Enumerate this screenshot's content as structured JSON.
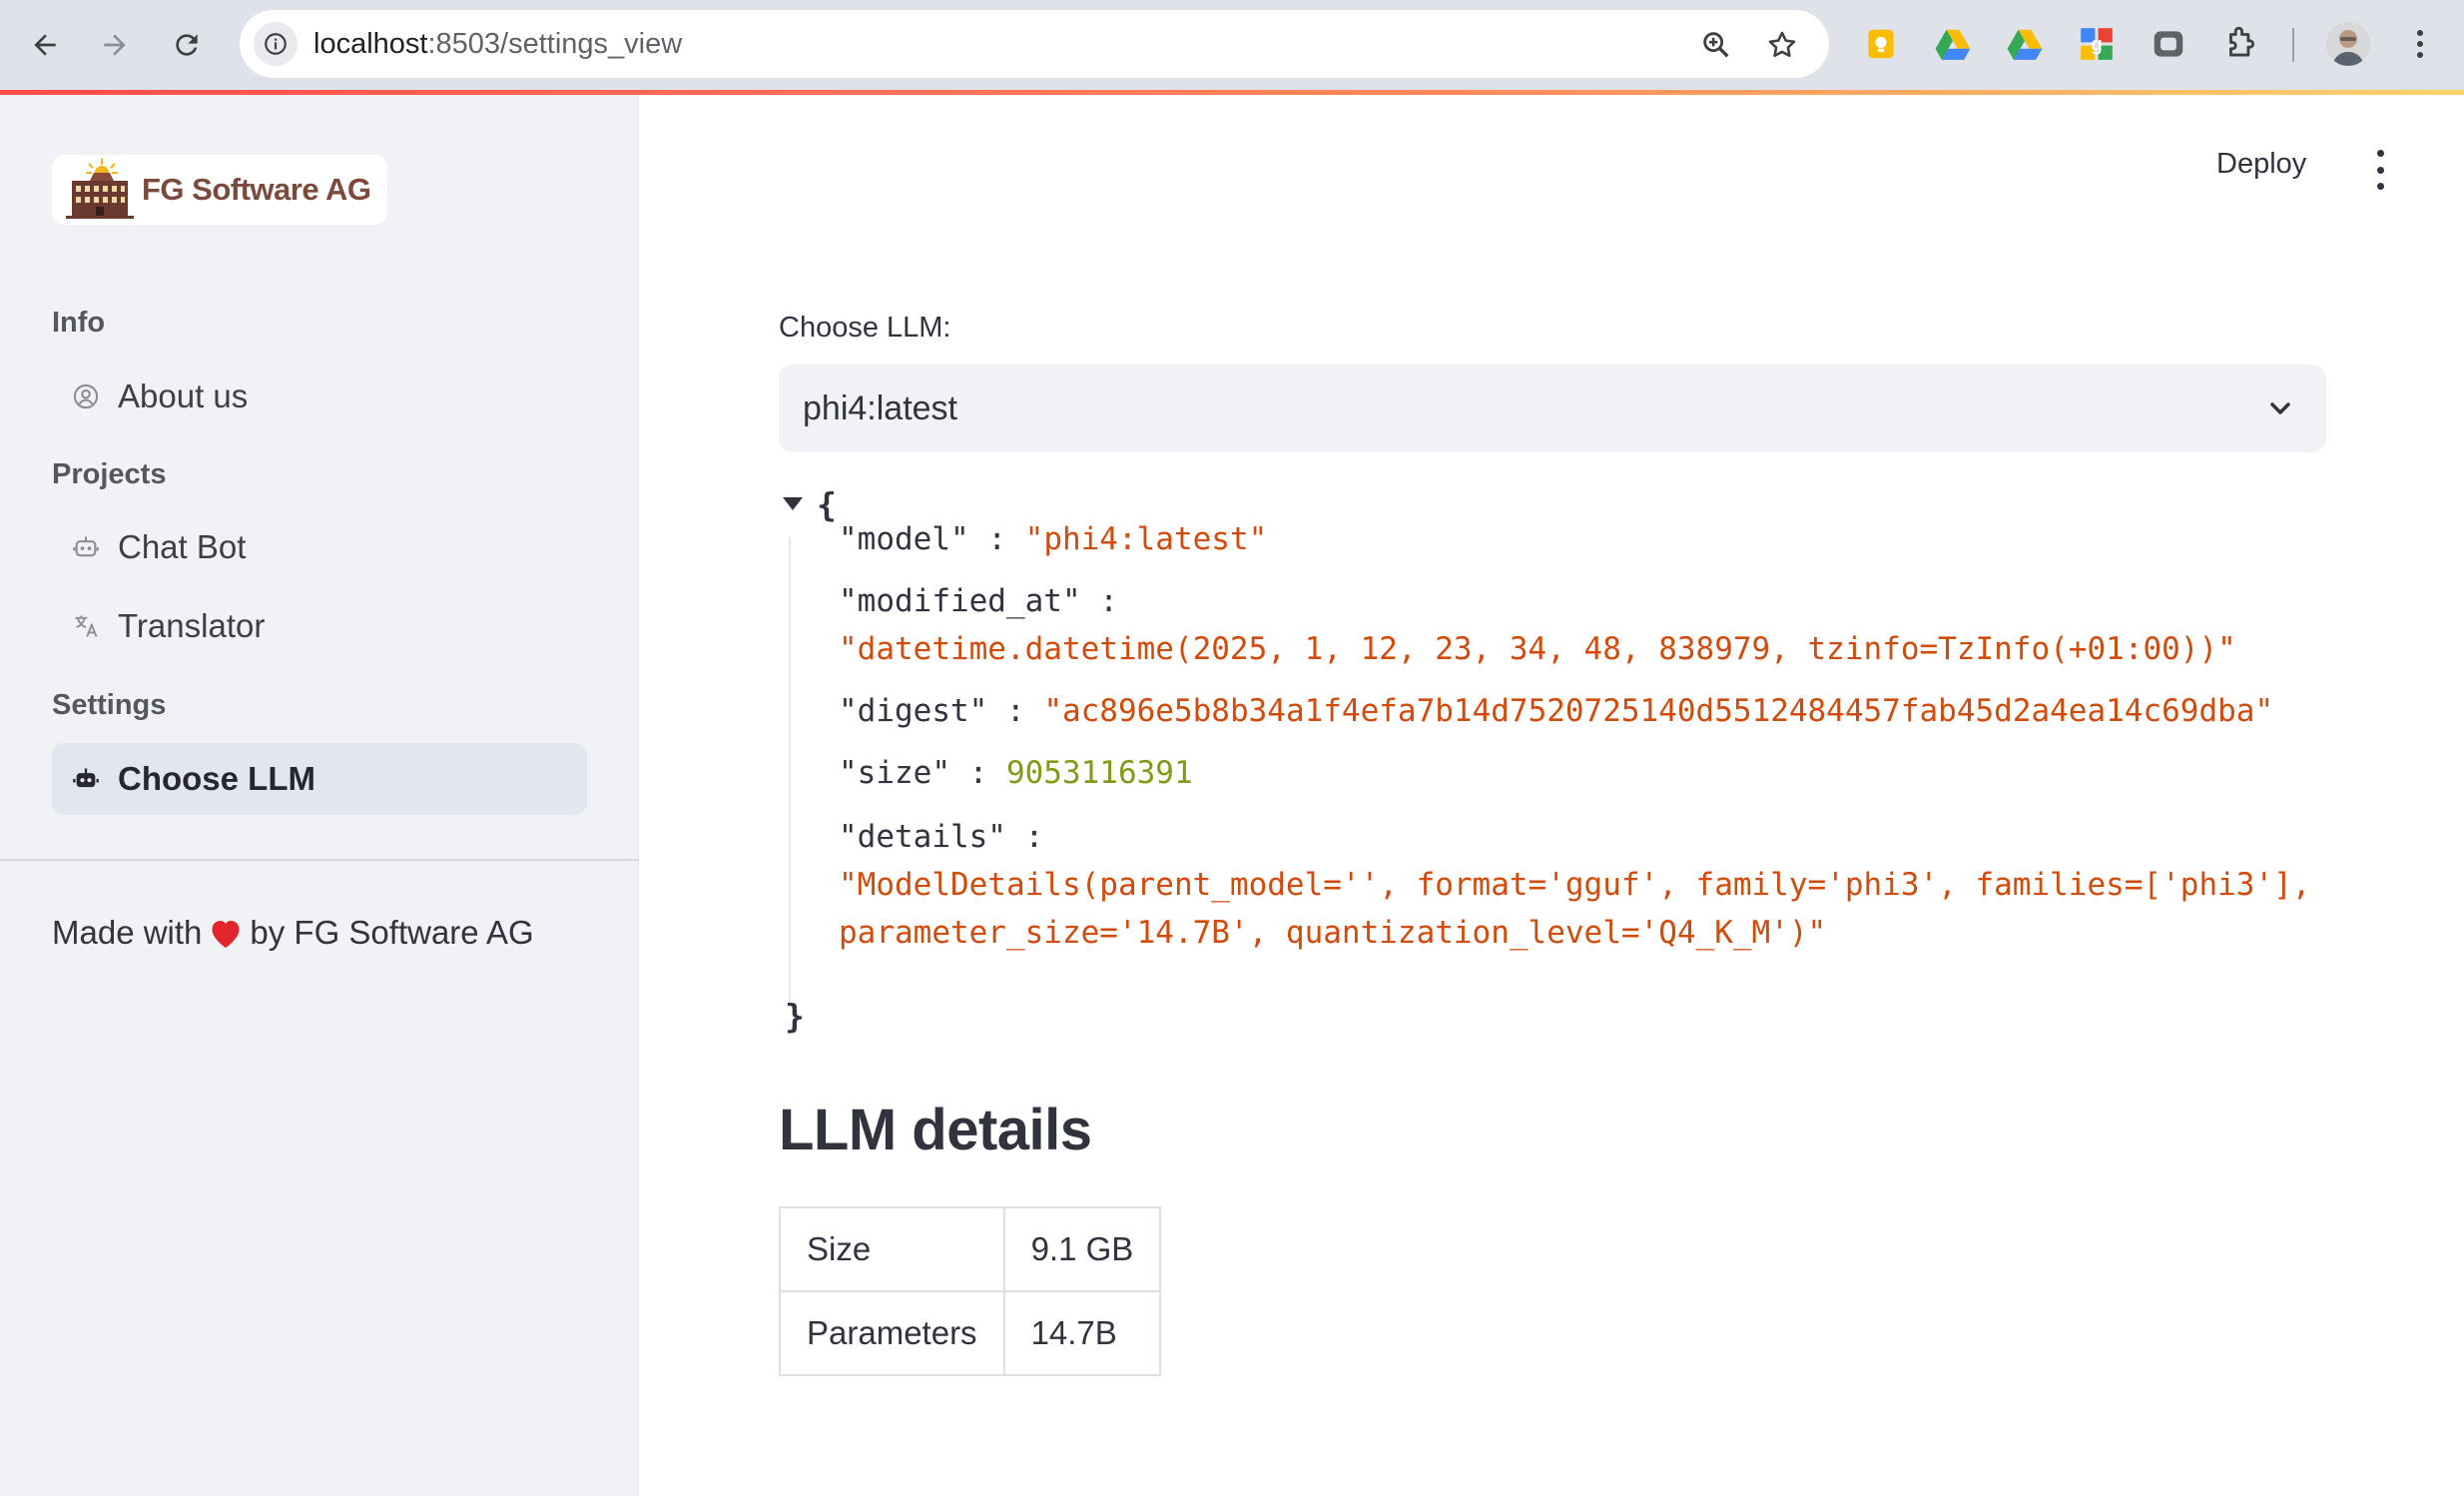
{
  "browser": {
    "url_host": "localhost",
    "url_path": ":8503/settings_view"
  },
  "sidebar": {
    "logo_text": "FG Software AG",
    "sections": {
      "info": "Info",
      "projects": "Projects",
      "settings": "Settings"
    },
    "items": [
      {
        "label": "About us",
        "icon": "user-circle-icon",
        "active": false
      },
      {
        "label": "Chat Bot",
        "icon": "robot-icon",
        "active": false
      },
      {
        "label": "Translator",
        "icon": "translate-icon",
        "active": false
      },
      {
        "label": "Choose LLM",
        "icon": "robot-icon",
        "active": true
      }
    ],
    "footer": {
      "before": "Made with",
      "after": "by FG Software AG"
    }
  },
  "header": {
    "deploy_label": "Deploy"
  },
  "main": {
    "select_label": "Choose LLM:",
    "select_value": "phi4:latest",
    "json": {
      "open_brace": "{",
      "close_brace": "}",
      "model_key": "\"model\"",
      "model_value": "\"phi4:latest\"",
      "modified_key": "\"modified_at\"",
      "modified_value": "\"datetime.datetime(2025, 1, 12, 23, 34, 48, 838979, tzinfo=TzInfo(+01:00))\"",
      "digest_key": "\"digest\"",
      "digest_value": "\"ac896e5b8b34a1f4efa7b14d7520725140d5512484457fab45d2a4ea14c69dba\"",
      "size_key": "\"size\"",
      "size_value": "9053116391",
      "details_key": "\"details\"",
      "details_value_1": "\"ModelDetails(parent_model='', format='gguf', family='phi3', families=['phi3'],",
      "details_value_2": "parameter_size='14.7B', quantization_level='Q4_K_M')\"",
      "colon": " : "
    },
    "heading": "LLM details",
    "table": [
      {
        "key": "Size",
        "value": "9.1 GB"
      },
      {
        "key": "Parameters",
        "value": "14.7B"
      }
    ]
  },
  "colors": {
    "accent_red": "#ff4b4b",
    "json_string": "#d14b0c",
    "json_number": "#7f9b17"
  }
}
